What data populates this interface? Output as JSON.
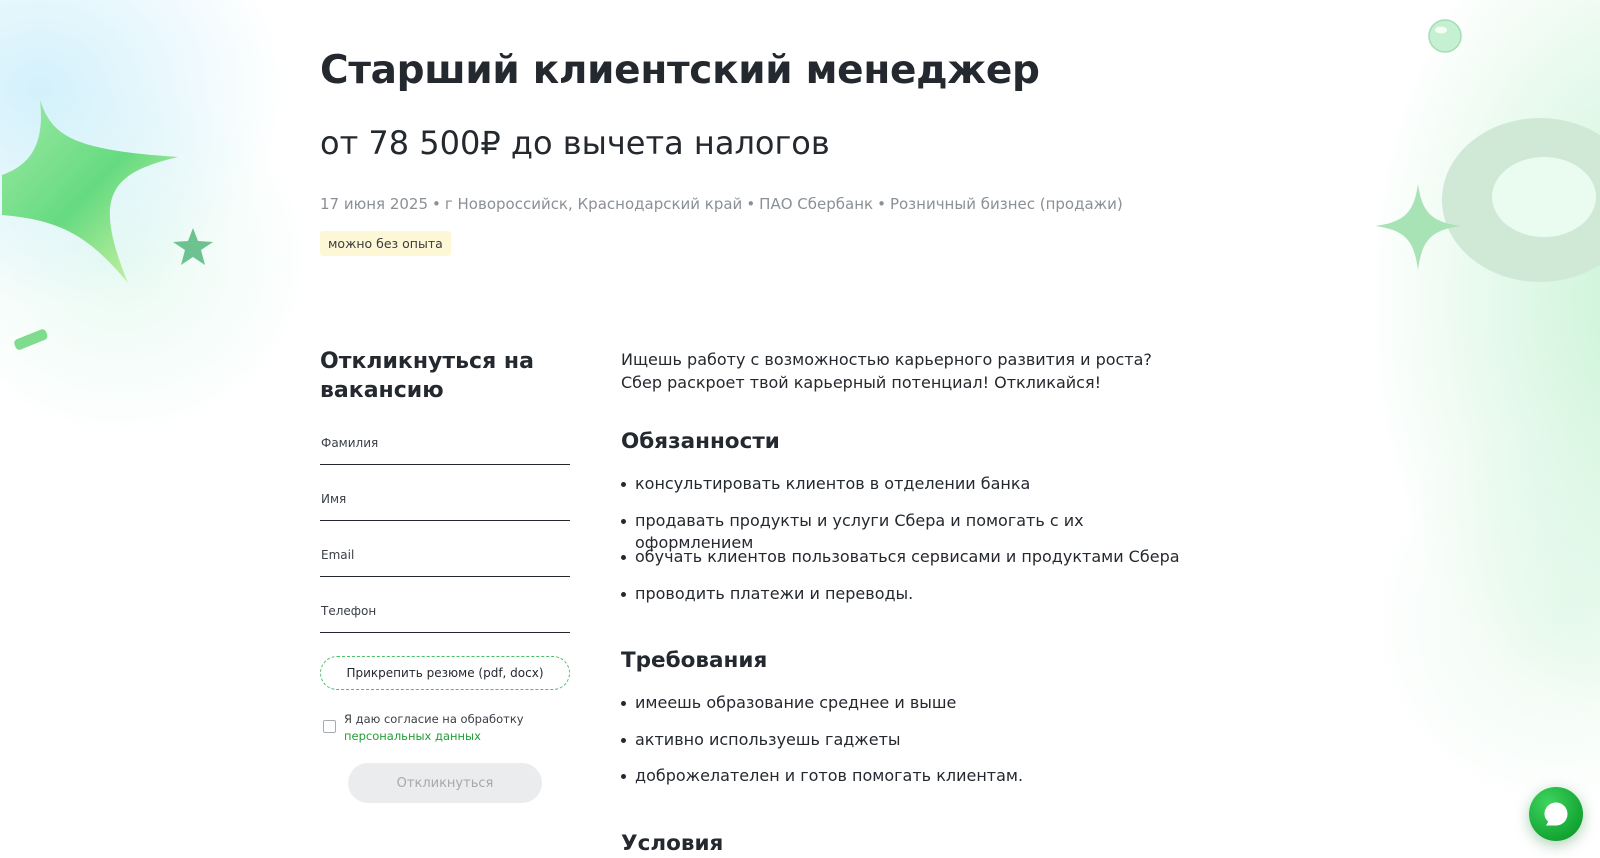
{
  "vacancy": {
    "title": "Старший клиентский менеджер",
    "salary": "от 78 500₽ до вычета налогов",
    "meta": {
      "date": "17 июня 2025",
      "location": "г Новороссийск, Краснодарский край",
      "company": "ПАО Сбербанк",
      "department": "Розничный бизнес (продажи)",
      "separator": "•"
    },
    "tag": "можно без опыта"
  },
  "apply_form": {
    "title": "Откликнуться на вакансию",
    "fields": [
      {
        "label": "Фамилия",
        "value": ""
      },
      {
        "label": "Имя",
        "value": ""
      },
      {
        "label": "Email",
        "value": ""
      },
      {
        "label": "Телефон",
        "value": ""
      }
    ],
    "attach_label": "Прикрепить резюме (pdf, docx)",
    "consent_text": "Я даю согласие на обработку",
    "consent_link": "персональных данных",
    "consent_checked": false,
    "submit_label": "Откликнуться"
  },
  "description": {
    "intro": [
      "Ищешь работу с возможностью карьерного развития и роста?",
      "Сбер раскроет твой карьерный потенциал! Откликайся!"
    ],
    "sections": [
      {
        "title": "Обязанности",
        "items": [
          "консультировать клиентов в отделении банка",
          "продавать продукты и услуги Сбера и помогать с их оформлением",
          "обучать клиентов пользоваться сервисами и продуктами Сбера",
          "проводить платежи и переводы."
        ]
      },
      {
        "title": "Требования",
        "items": [
          "имеешь образование среднее и выше",
          "активно используешь гаджеты",
          "доброжелателен и готов помогать клиентам."
        ]
      },
      {
        "title": "Условия",
        "items": []
      }
    ]
  },
  "colors": {
    "brand_green": "#21a038",
    "text": "#24292f",
    "muted": "#8a9096",
    "tag_bg": "#fdf7d6",
    "disabled_bg": "#ebeced"
  },
  "icons": {
    "chat": "chat-bubble-icon",
    "decor_left": "green-star-decoration",
    "decor_right": "green-torus-decoration"
  }
}
